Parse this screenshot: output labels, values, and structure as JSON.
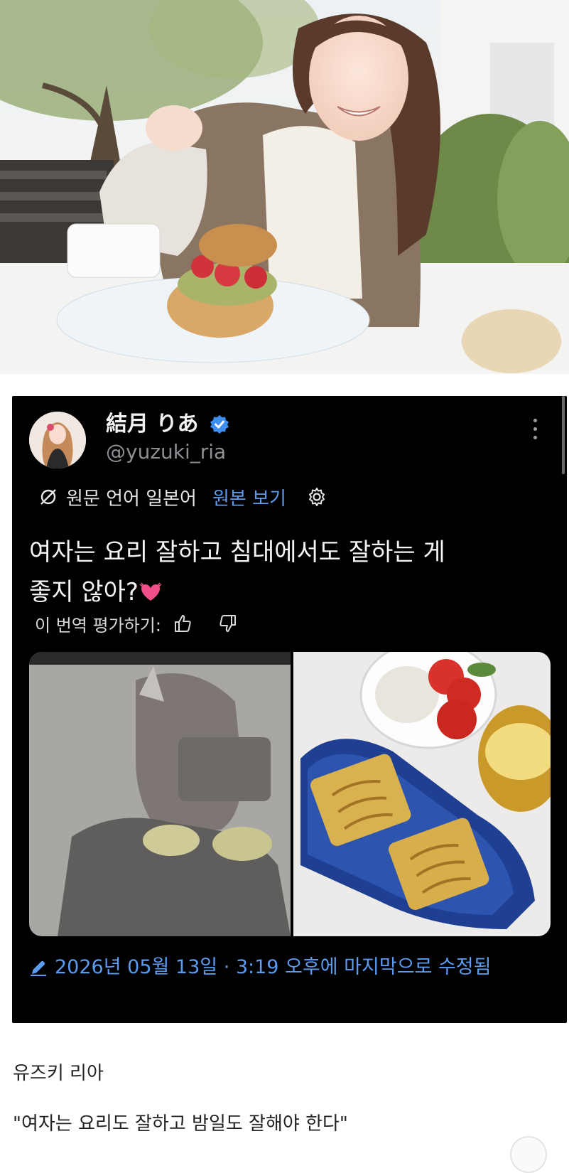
{
  "profile": {
    "display_name": "結月 りあ",
    "handle": "@yuzuki_ria",
    "verified_icon": "verified-badge-icon"
  },
  "translation": {
    "source_note": "원문 언어 일본어",
    "view_original": "원본 보기"
  },
  "tweet": {
    "line1": "여자는 요리 잘하고 침대에서도 잘하는 게",
    "line2": "좋지 않아?",
    "emoji": "heart-emoji"
  },
  "rating": {
    "label": "이 번역 평가하기:"
  },
  "edited": {
    "text": "2026년 05월 13일 · 3:19 오후에 마지막으로 수정됨"
  },
  "captions": {
    "author": "유즈키 리아",
    "quote": "\"여자는 요리도 잘하고 밤일도 잘해야 한다\""
  },
  "colors": {
    "card_bg": "#000000",
    "link_blue": "#5b9cf0",
    "badge_blue": "#3d8ef0"
  }
}
